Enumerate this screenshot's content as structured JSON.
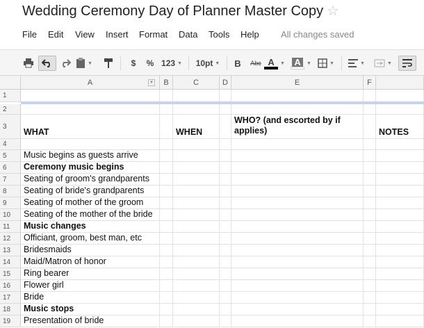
{
  "title": "Wedding Ceremony Day of Planner Master Copy",
  "menu": [
    "File",
    "Edit",
    "View",
    "Insert",
    "Format",
    "Data",
    "Tools",
    "Help"
  ],
  "save_status": "All changes saved",
  "toolbar": {
    "currency": "$",
    "percent": "%",
    "more_formats": "123",
    "font_size": "10pt",
    "bold": "B",
    "strikethrough": "Abc",
    "text_color": "A",
    "fill_color": "A",
    "colors": {
      "text": "#000000",
      "fill": "#ffffff"
    }
  },
  "columns": [
    "A",
    "B",
    "C",
    "D",
    "E",
    "F"
  ],
  "rows": [
    {
      "num": "1",
      "cells": [
        "",
        "",
        "",
        "",
        "",
        ""
      ]
    },
    {
      "num": "2",
      "cells": [
        "",
        "",
        "",
        "",
        "",
        ""
      ]
    },
    {
      "num": "3",
      "cells": [
        "WHAT",
        "",
        "WHEN",
        "",
        "WHO? (and escorted by if applies)",
        "",
        "NOTES"
      ]
    },
    {
      "num": "4",
      "cells": [
        "",
        "",
        "",
        "",
        "",
        ""
      ]
    },
    {
      "num": "5",
      "cells": [
        "Music begins as guests arrive"
      ]
    },
    {
      "num": "6",
      "cells": [
        "Ceremony music begins"
      ]
    },
    {
      "num": "7",
      "cells": [
        "Seating of groom's grandparents"
      ]
    },
    {
      "num": "8",
      "cells": [
        "Seating of bride's grandparents"
      ]
    },
    {
      "num": "9",
      "cells": [
        "Seating of mother of the groom"
      ]
    },
    {
      "num": "10",
      "cells": [
        "Seating of the mother of the bride"
      ]
    },
    {
      "num": "11",
      "cells": [
        "Music changes"
      ]
    },
    {
      "num": "12",
      "cells": [
        "Officiant, groom, best man, etc"
      ]
    },
    {
      "num": "13",
      "cells": [
        "Bridesmaids"
      ]
    },
    {
      "num": "14",
      "cells": [
        "Maid/Matron of honor"
      ]
    },
    {
      "num": "15",
      "cells": [
        "Ring bearer"
      ]
    },
    {
      "num": "16",
      "cells": [
        "Flower girl"
      ]
    },
    {
      "num": "17",
      "cells": [
        "Bride"
      ]
    },
    {
      "num": "18",
      "cells": [
        "Music stops"
      ]
    },
    {
      "num": "19",
      "cells": [
        "Presentation of bride"
      ]
    }
  ],
  "bold_rows": [
    "3",
    "6",
    "11",
    "18"
  ]
}
